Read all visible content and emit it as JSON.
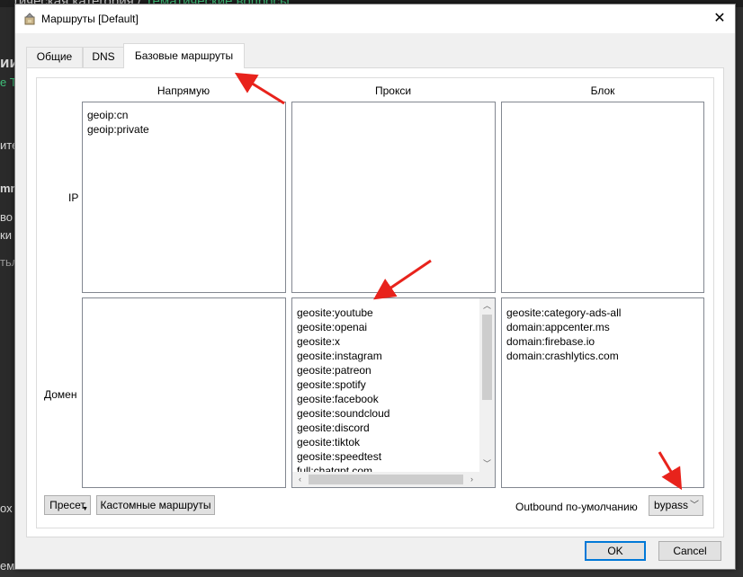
{
  "background": {
    "crumb_partial": "тическая категория",
    "crumb_sep": "/",
    "crumb_link": "Тематические вопросы",
    "fragments": [
      "ии",
      "е Тс",
      "ите",
      "mm",
      "во",
      "ки",
      "тьл",
      "ох з",
      "ем"
    ]
  },
  "dialog": {
    "title": "Маршруты [Default]",
    "close_glyph": "✕"
  },
  "tabs": [
    {
      "label": "Общие"
    },
    {
      "label": "DNS"
    },
    {
      "label": "Базовые маршруты",
      "active": true
    }
  ],
  "columns": {
    "direct": "Напрямую",
    "proxy": "Прокси",
    "block": "Блок"
  },
  "rows": {
    "ip": "IP",
    "domain": "Домен"
  },
  "lists": {
    "direct_ip": [
      "geoip:cn",
      "geoip:private"
    ],
    "proxy_ip": [],
    "block_ip": [],
    "direct_domain": [],
    "proxy_domain": [
      "geosite:youtube",
      "geosite:openai",
      "geosite:x",
      "geosite:instagram",
      "geosite:patreon",
      "geosite:spotify",
      "geosite:facebook",
      "geosite:soundcloud",
      "geosite:discord",
      "geosite:tiktok",
      "geosite:speedtest",
      "full:chatgpt.com"
    ],
    "block_domain": [
      "geosite:category-ads-all",
      "domain:appcenter.ms",
      "domain:firebase.io",
      "domain:crashlytics.com"
    ]
  },
  "buttons": {
    "preset": "Пресет",
    "custom_routes": "Кастомные маршруты",
    "ok": "OK",
    "cancel": "Cancel"
  },
  "outbound": {
    "label": "Outbound по-умолчанию",
    "value": "bypass"
  },
  "icons": {
    "app": "app-icon",
    "close": "close-icon",
    "chevron": "chevron-down-icon",
    "annotation": "red-arrow-annotation"
  },
  "colors": {
    "accent": "#0078d7",
    "annotation": "#e8231c"
  }
}
